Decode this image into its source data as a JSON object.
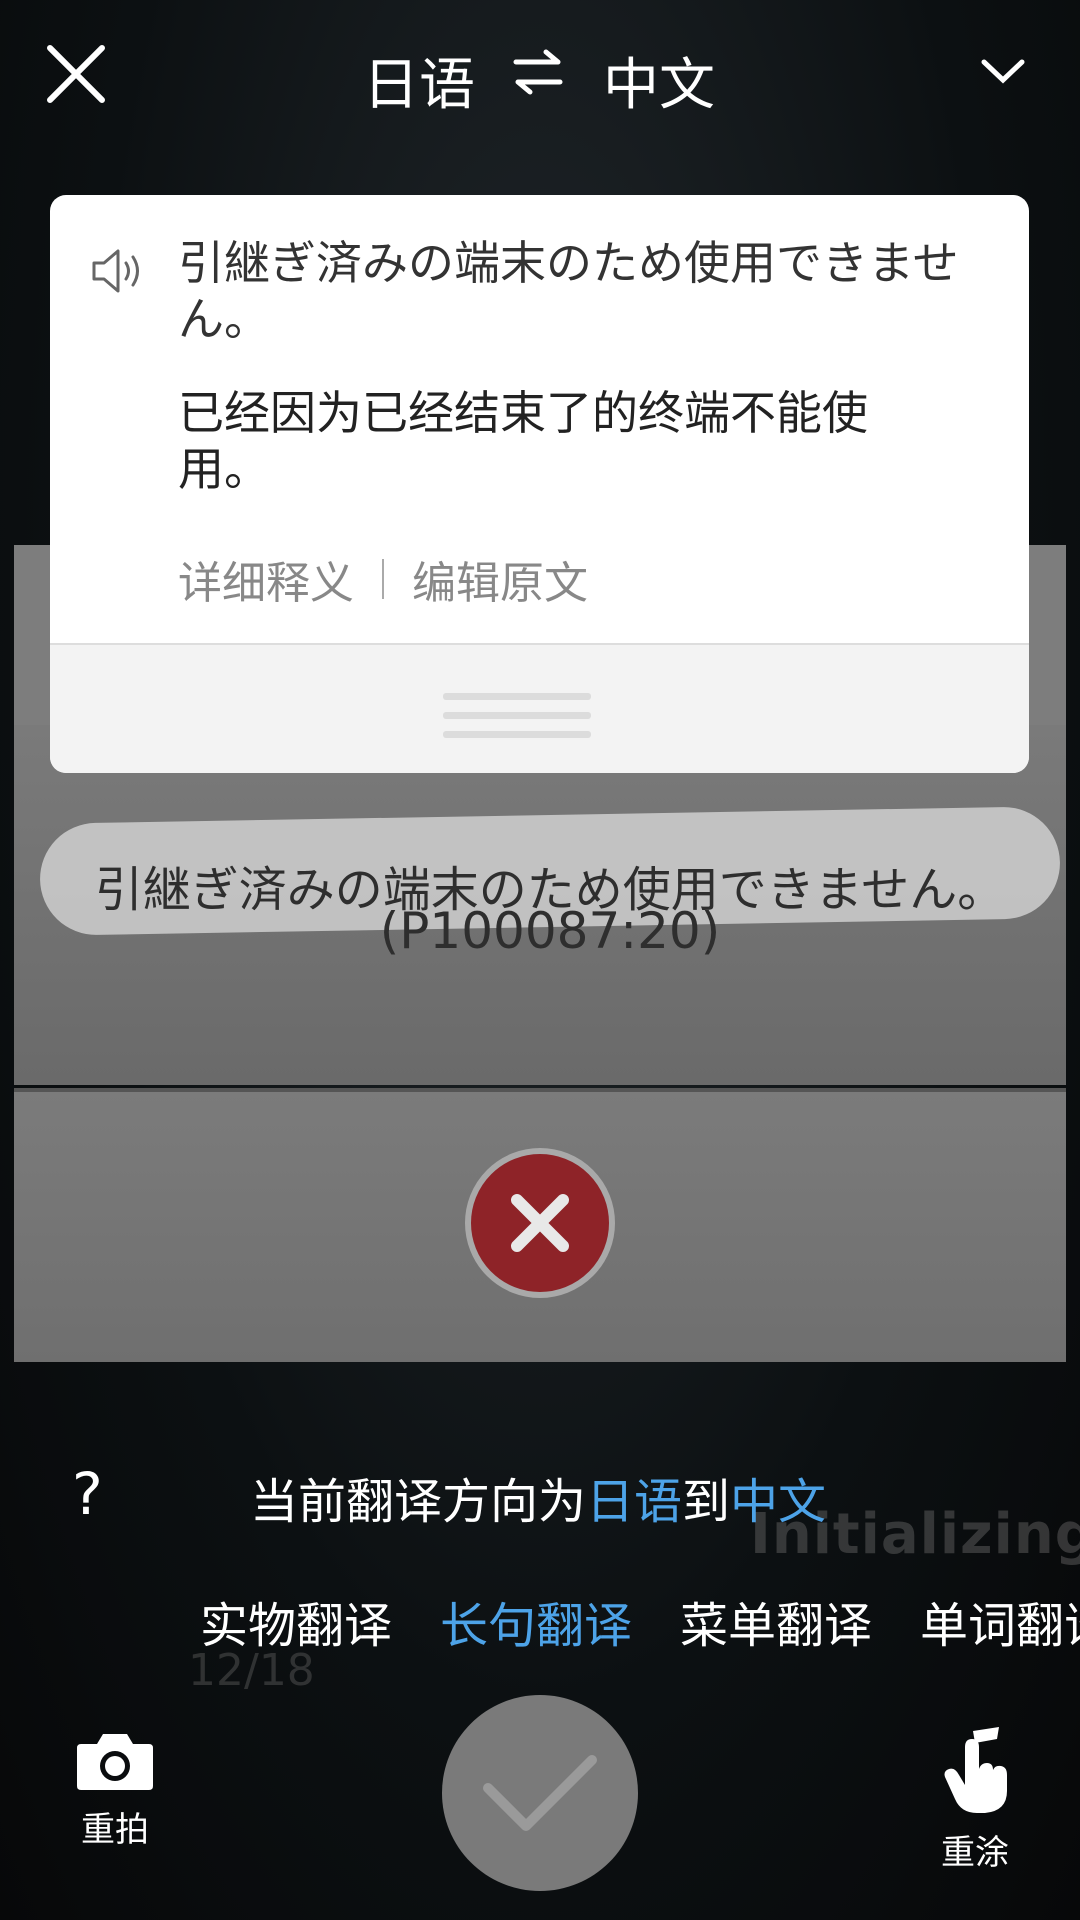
{
  "top_bar": {
    "source_language": "日语",
    "target_language": "中文",
    "icons": [
      "close-icon",
      "swap-icon",
      "chevron-down-icon"
    ]
  },
  "card": {
    "source_text": "引継ぎ済みの端末のため使用できません。",
    "translation_text": "已经因为已经结束了的终端不能使用。",
    "detail_label": "详细释义",
    "edit_label": "编辑原文"
  },
  "captured_image": {
    "source_text": "引継ぎ済みの端末のため使用できません。",
    "error_code": "(P100087:20)",
    "loading_text": "Initializing",
    "counter_text": "12/18"
  },
  "direction": {
    "prefix": "当前翻译方向为",
    "from": "日语",
    "middle": "到",
    "to": "中文"
  },
  "modes": {
    "tabs": [
      "实物翻译",
      "长句翻译",
      "菜单翻译",
      "单词翻译"
    ],
    "active_index": 1
  },
  "bottom_bar": {
    "retake_label": "重拍",
    "repaint_label": "重涂"
  },
  "colors": {
    "accent": "#4da3e8",
    "error_red": "#8e2328"
  }
}
